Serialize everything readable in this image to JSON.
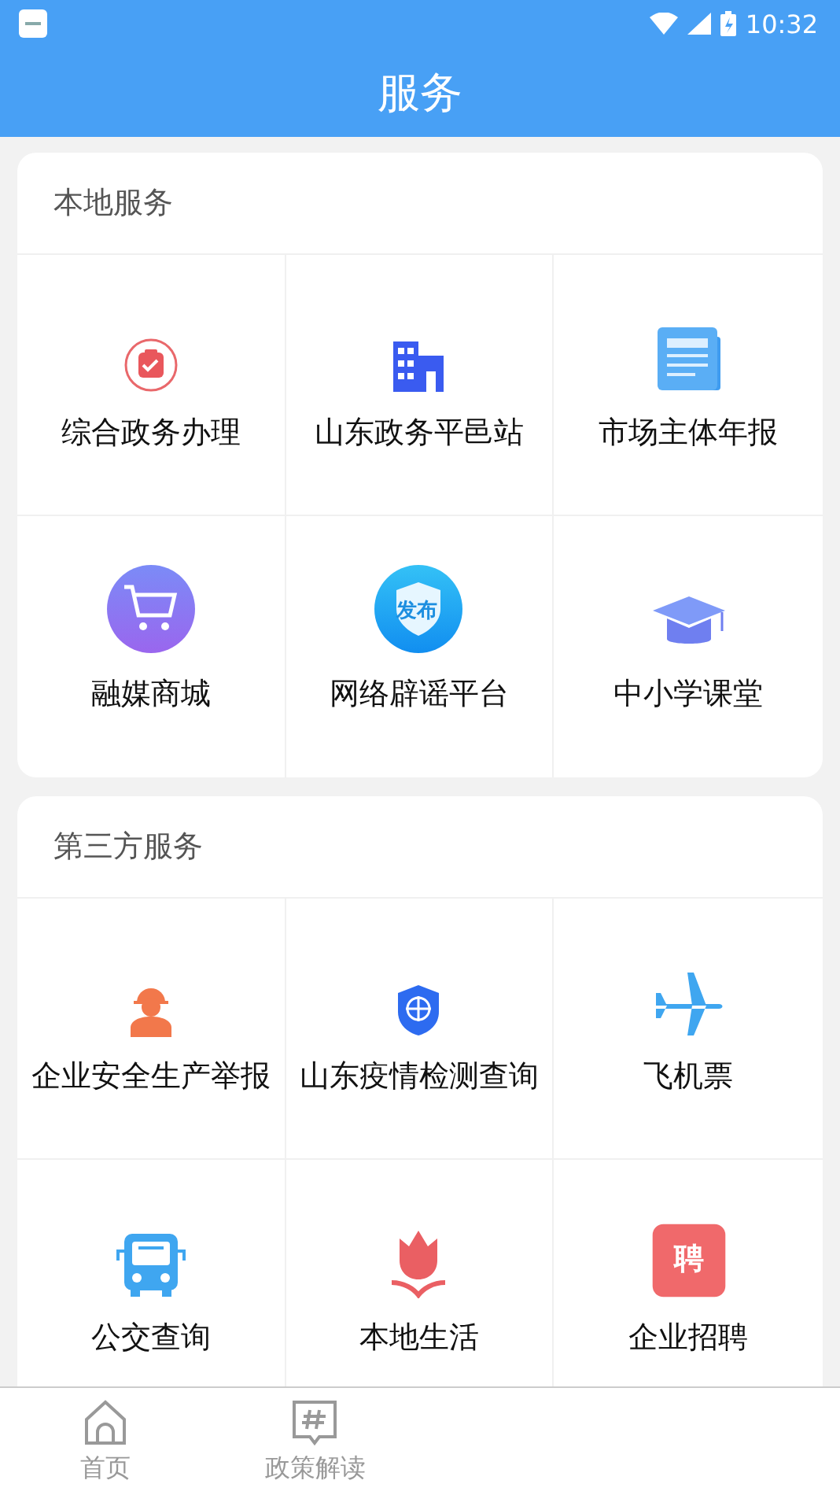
{
  "status_bar": {
    "time": "10:32"
  },
  "header": {
    "title": "服务"
  },
  "sections": [
    {
      "title": "本地服务",
      "items": [
        {
          "label": "综合政务办理"
        },
        {
          "label": "山东政务平邑站"
        },
        {
          "label": "市场主体年报"
        },
        {
          "label": "融媒商城"
        },
        {
          "label": "网络辟谣平台",
          "badge": "发布"
        },
        {
          "label": "中小学课堂"
        }
      ]
    },
    {
      "title": "第三方服务",
      "items": [
        {
          "label": "企业安全生产举报"
        },
        {
          "label": "山东疫情检测查询"
        },
        {
          "label": "飞机票"
        },
        {
          "label": "公交查询"
        },
        {
          "label": "本地生活"
        },
        {
          "label": "企业招聘",
          "badge": "聘"
        }
      ]
    }
  ],
  "bottom_nav": [
    {
      "label": "首页",
      "selected": false
    },
    {
      "label": "政策解读",
      "selected": false
    }
  ]
}
